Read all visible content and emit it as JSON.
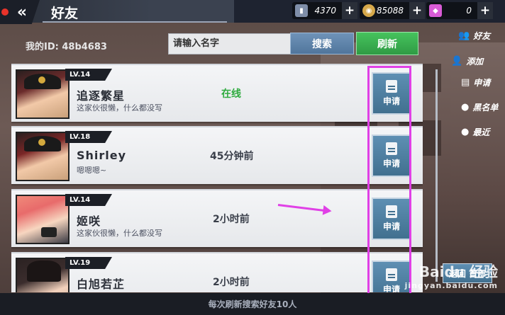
{
  "header": {
    "back_icon": "double-chevron-left-icon",
    "title": "好友",
    "resources": [
      {
        "icon": "battery-icon",
        "value": "4370",
        "plus": "+",
        "color": "#7f8ea8"
      },
      {
        "icon": "coin-icon",
        "value": "85088",
        "plus": "+",
        "color": "#d6a84a"
      },
      {
        "icon": "diamond-icon",
        "value": "0",
        "plus": "+",
        "color": "#d95bd6"
      }
    ]
  },
  "search": {
    "my_id": "我的ID: 48b4683",
    "placeholder": "请输入名字",
    "search_label": "搜索",
    "refresh_label": "刷新"
  },
  "side_menu": [
    {
      "icon": "friends-icon",
      "label": "好友"
    },
    {
      "icon": "add-user-icon",
      "label": "添加"
    },
    {
      "icon": "request-icon",
      "label": "申请"
    },
    {
      "icon": "blacklist-icon",
      "label": "黑名单"
    },
    {
      "icon": "recent-icon",
      "label": "最近"
    }
  ],
  "players": [
    {
      "level": "LV.14",
      "name": "追逐繁星",
      "signature": "这家伙很懒，什么都没写",
      "status": "在线",
      "online": true,
      "apply": "申请"
    },
    {
      "level": "LV.18",
      "name": "Shirley",
      "signature": "嗯嗯嗯~",
      "status": "45分钟前",
      "online": false,
      "apply": "申请"
    },
    {
      "level": "LV.14",
      "name": "姬咲",
      "signature": "这家伙很懒，什么都没写",
      "status": "2小时前",
      "online": false,
      "apply": "申请"
    },
    {
      "level": "LV.19",
      "name": "白旭若芷",
      "signature": "",
      "status": "2小时前",
      "online": false,
      "apply": "申请"
    }
  ],
  "back_home": "返回 首部",
  "footer": "每次刷新搜索好友10人",
  "watermark": {
    "main": "Baidu 经验",
    "sub": "jingyan.baidu.com"
  },
  "colors": {
    "online": "#2fab3f",
    "highlight": "#e040e6",
    "refresh": "#3aae50",
    "search": "#5f84aa"
  }
}
